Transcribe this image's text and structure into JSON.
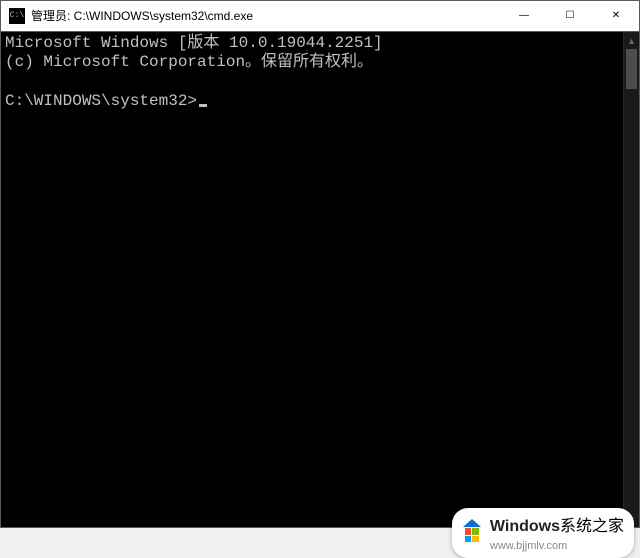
{
  "window": {
    "title": "管理员: C:\\WINDOWS\\system32\\cmd.exe",
    "icon_label": "C:\\"
  },
  "controls": {
    "minimize": "—",
    "maximize": "☐",
    "close": "✕"
  },
  "console": {
    "line1": "Microsoft Windows [版本 10.0.19044.2251]",
    "line2": "(c) Microsoft Corporation。保留所有权利。",
    "blank": "",
    "prompt": "C:\\WINDOWS\\system32>"
  },
  "scrollbar": {
    "up": "▲",
    "down": "▼"
  },
  "watermark": {
    "brand": "Windows",
    "suffix": "系统之家",
    "url": "www.bjjmlv.com"
  }
}
